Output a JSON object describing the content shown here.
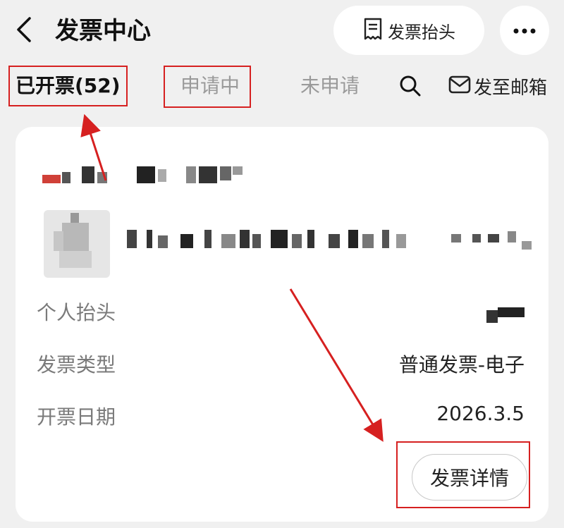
{
  "header": {
    "title": "发票中心",
    "invoice_header_button": "发票抬头",
    "more_button_icon": "more-dots-icon"
  },
  "tabs": [
    {
      "label": "已开票(52)",
      "active": true
    },
    {
      "label": "申请中",
      "active": false
    },
    {
      "label": "未申请",
      "active": false
    }
  ],
  "actions": {
    "search_icon": "search-icon",
    "send_to_email": "发至邮箱"
  },
  "invoice_card": {
    "rows": [
      {
        "label": "个人抬头",
        "value": ""
      },
      {
        "label": "发票类型",
        "value": "普通发票-电子"
      },
      {
        "label": "开票日期",
        "value": "2026.3.5"
      }
    ],
    "detail_button": "发票详情"
  },
  "colors": {
    "background": "#f0f0f0",
    "card": "#ffffff",
    "annotation_red": "#d62020",
    "muted_text": "#9a9a9a"
  }
}
